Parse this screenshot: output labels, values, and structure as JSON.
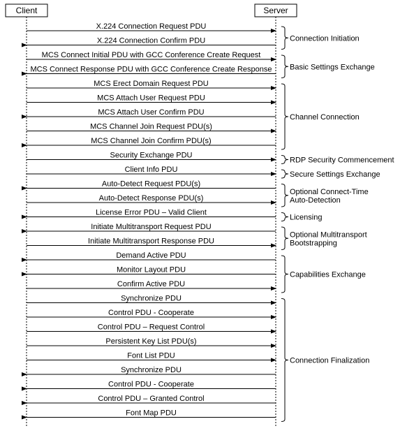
{
  "participants": {
    "client": "Client",
    "server": "Server"
  },
  "messages": [
    {
      "label": "X.224 Connection Request PDU",
      "dir": "cs"
    },
    {
      "label": "X.224 Connection Confirm PDU",
      "dir": "sc"
    },
    {
      "label": "MCS Connect Initial PDU with GCC Conference Create Request",
      "dir": "cs"
    },
    {
      "label": "MCS Connect Response PDU with GCC Conference Create Response",
      "dir": "sc"
    },
    {
      "label": "MCS Erect Domain Request PDU",
      "dir": "cs"
    },
    {
      "label": "MCS Attach User Request PDU",
      "dir": "cs"
    },
    {
      "label": "MCS Attach User Confirm PDU",
      "dir": "sc"
    },
    {
      "label": "MCS Channel Join Request PDU(s)",
      "dir": "cs"
    },
    {
      "label": "MCS Channel Join Confirm PDU(s)",
      "dir": "sc"
    },
    {
      "label": "Security Exchange PDU",
      "dir": "cs"
    },
    {
      "label": "Client Info PDU",
      "dir": "cs"
    },
    {
      "label": "Auto-Detect Request PDU(s)",
      "dir": "sc"
    },
    {
      "label": "Auto-Detect Response PDU(s)",
      "dir": "cs"
    },
    {
      "label": "License Error PDU – Valid Client",
      "dir": "sc"
    },
    {
      "label": "Initiate Multitransport Request PDU",
      "dir": "sc"
    },
    {
      "label": "Initiate Multitransport Response PDU",
      "dir": "cs"
    },
    {
      "label": "Demand Active PDU",
      "dir": "sc"
    },
    {
      "label": "Monitor Layout PDU",
      "dir": "sc"
    },
    {
      "label": "Confirm Active PDU",
      "dir": "cs"
    },
    {
      "label": "Synchronize PDU",
      "dir": "cs"
    },
    {
      "label": "Control PDU - Cooperate",
      "dir": "cs"
    },
    {
      "label": "Control PDU – Request Control",
      "dir": "cs"
    },
    {
      "label": "Persistent Key List PDU(s)",
      "dir": "cs"
    },
    {
      "label": "Font List PDU",
      "dir": "cs"
    },
    {
      "label": "Synchronize PDU",
      "dir": "sc"
    },
    {
      "label": "Control PDU - Cooperate",
      "dir": "sc"
    },
    {
      "label": "Control PDU – Granted Control",
      "dir": "sc"
    },
    {
      "label": "Font Map PDU",
      "dir": "sc"
    }
  ],
  "phases": [
    {
      "label": "Connection Initiation",
      "from": 0,
      "to": 1
    },
    {
      "label": "Basic Settings Exchange",
      "from": 2,
      "to": 3
    },
    {
      "label": "Channel Connection",
      "from": 4,
      "to": 8
    },
    {
      "label": "RDP Security Commencement",
      "from": 9,
      "to": 9
    },
    {
      "label": "Secure Settings Exchange",
      "from": 10,
      "to": 10
    },
    {
      "label": "Optional Connect-Time Auto-Detection",
      "from": 11,
      "to": 12,
      "wrap": true
    },
    {
      "label": "Licensing",
      "from": 13,
      "to": 13
    },
    {
      "label": "Optional Multitransport Bootstrapping",
      "from": 14,
      "to": 15,
      "wrap": true
    },
    {
      "label": "Capabilities Exchange",
      "from": 16,
      "to": 18
    },
    {
      "label": "Connection Finalization",
      "from": 19,
      "to": 27
    }
  ]
}
